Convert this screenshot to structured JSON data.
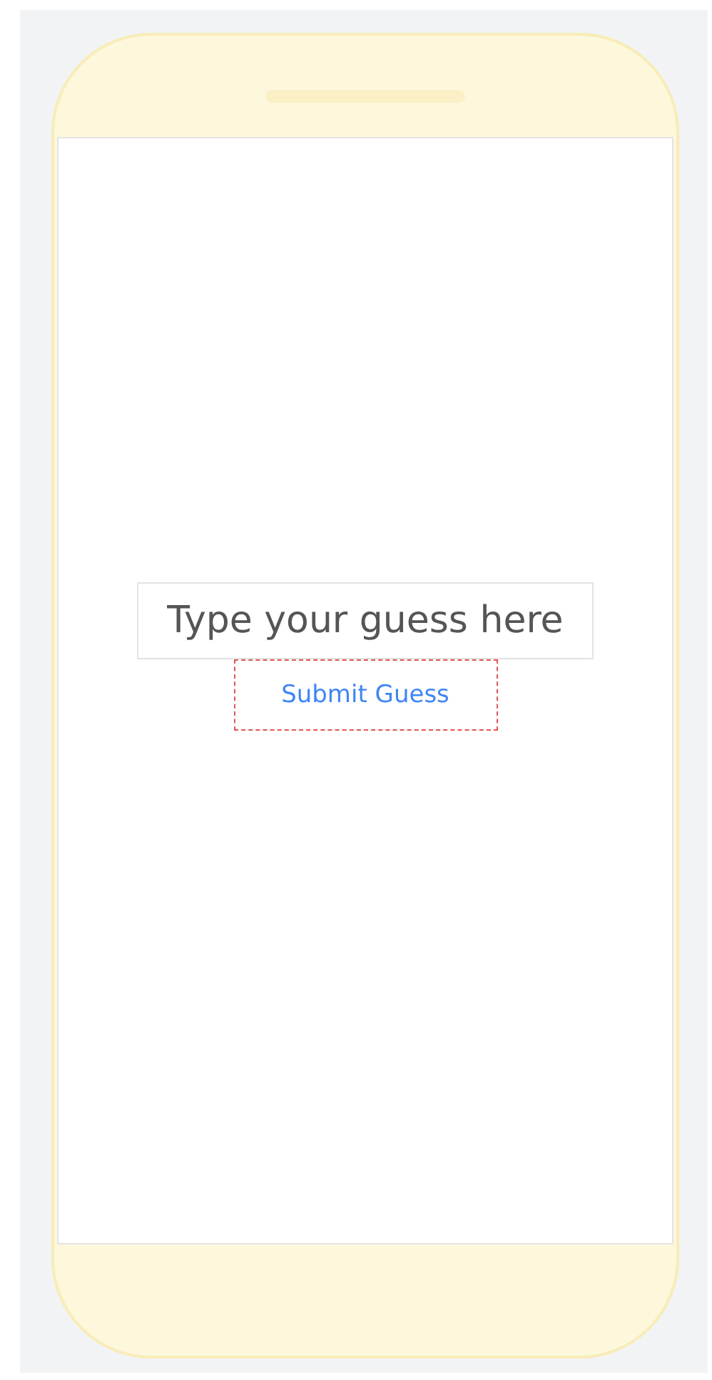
{
  "guess_field": {
    "placeholder": "Type your guess here"
  },
  "submit_button": {
    "label": "Submit Guess"
  }
}
